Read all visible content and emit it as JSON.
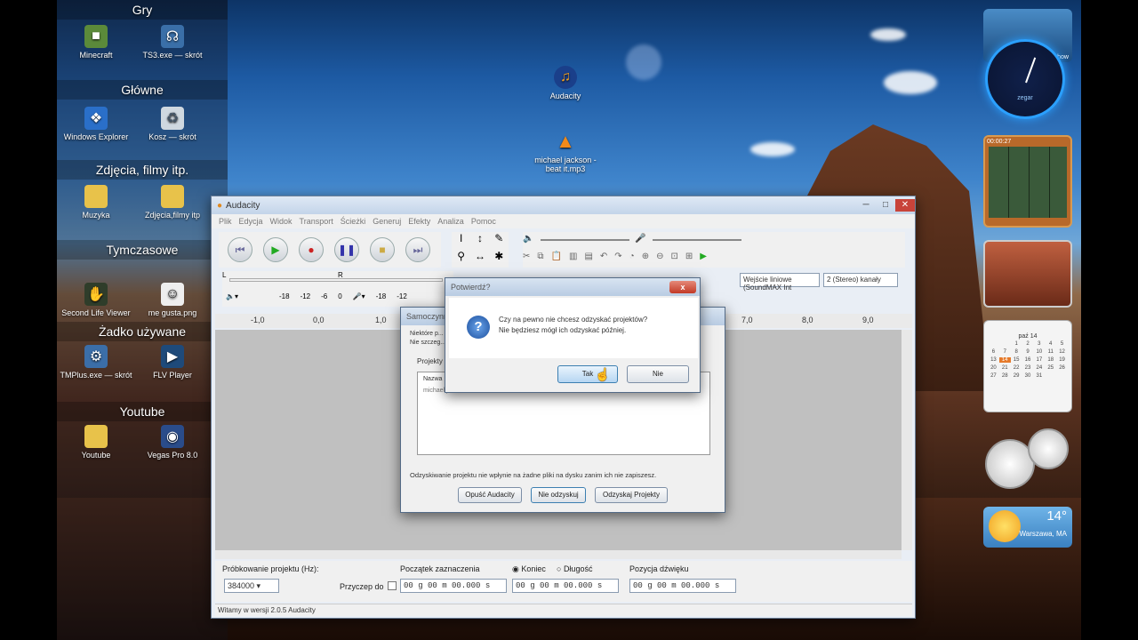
{
  "desktop": {
    "groups": [
      {
        "title": "Gry",
        "icons": [
          {
            "label": "Minecraft",
            "icon": "minecraft-icon"
          },
          {
            "label": "TS3.exe — skrót",
            "icon": "teamspeak-icon"
          }
        ]
      },
      {
        "title": "Główne",
        "icons": [
          {
            "label": "Windows Explorer",
            "icon": "explorer-icon"
          },
          {
            "label": "Kosz — skrót",
            "icon": "recycle-bin-icon"
          }
        ]
      },
      {
        "title": "Zdjęcia, filmy itp.",
        "icons": [
          {
            "label": "Muzyka",
            "icon": "folder-icon"
          },
          {
            "label": "Zdjęcia,filmy itp",
            "icon": "folder-icon"
          }
        ]
      },
      {
        "title": "Tymczasowe",
        "icons": [
          {
            "label": "Second Life Viewer",
            "icon": "second-life-icon"
          },
          {
            "label": "me gusta.png",
            "icon": "image-icon"
          }
        ]
      },
      {
        "title": "Żadko używane",
        "icons": [
          {
            "label": "TMPlus.exe — skrót",
            "icon": "tmplus-icon"
          },
          {
            "label": "FLV Player",
            "icon": "flv-player-icon"
          }
        ]
      },
      {
        "title": "Youtube",
        "icons": [
          {
            "label": "Youtube",
            "icon": "folder-icon"
          },
          {
            "label": "Vegas Pro 8.0",
            "icon": "vegas-icon"
          }
        ]
      }
    ],
    "free_icons": [
      {
        "label": "Audacity",
        "icon": "audacity-icon"
      },
      {
        "label": "michael jackson - beat it.mp3",
        "icon": "vlc-icon"
      }
    ],
    "gadgets": {
      "clock_label": "zegar",
      "slideshow_label": "Slideshow",
      "puzzle_time": "00:00:27",
      "calendar_month": "paź 14",
      "calendar_days": [
        "1",
        "2",
        "3",
        "4",
        "5",
        "6",
        "7",
        "8",
        "9",
        "10",
        "11",
        "12",
        "13",
        "14",
        "15",
        "16",
        "17",
        "18",
        "19",
        "20",
        "21",
        "22",
        "23",
        "24",
        "25",
        "26",
        "27",
        "28",
        "29",
        "30",
        "31"
      ],
      "weather_temp": "14°",
      "weather_city": "Warszawa, MA"
    }
  },
  "audacity": {
    "title": "Audacity",
    "menu": [
      "Plik",
      "Edycja",
      "Widok",
      "Transport",
      "Ścieżki",
      "Generuj",
      "Efekty",
      "Analiza",
      "Pomoc"
    ],
    "meter_labels": {
      "l": "L",
      "r": "R"
    },
    "meter_scale": [
      "-18",
      "-12",
      "-6",
      "0"
    ],
    "device_label": "Wejście liniowe (SoundMAX Int",
    "channels_label": "2 (Stereo) kanały",
    "ruler": [
      "-1,0",
      "0,0",
      "1,0",
      "7,0",
      "8,0",
      "9,0"
    ],
    "rate_label": "Próbkowanie projektu (Hz):",
    "rate_value": "384000",
    "snap_label": "Przyczep do",
    "sel_start_label": "Początek zaznaczenia",
    "end_label": "Koniec",
    "length_label": "Długość",
    "pos_label": "Pozycja dźwięku",
    "time_value": "00 g 00 m 00.000 s",
    "status": "Witamy w wersji 2.0.5 Audacity"
  },
  "recovery": {
    "title": "Samoczynne...",
    "text1": "Niektóre p...",
    "text2": "Nie szczeg...",
    "group": "Projekty",
    "col_name": "Nazwa",
    "row": "michael jackson - beat it  2014-10-14 16:26:33",
    "note": "Odzyskiwanie projektu nie wpłynie na żadne pliki na dysku zanim ich nie zapiszesz.",
    "btn_quit": "Opuść Audacity",
    "btn_no": "Nie odzyskuj",
    "btn_recover": "Odzyskaj Projekty"
  },
  "confirm": {
    "title": "Potwierdź?",
    "line1": "Czy na pewno nie chcesz odzyskać projektów?",
    "line2": "Nie będziesz mógł ich odzyskać później.",
    "yes": "Tak",
    "no": "Nie",
    "close": "x"
  }
}
